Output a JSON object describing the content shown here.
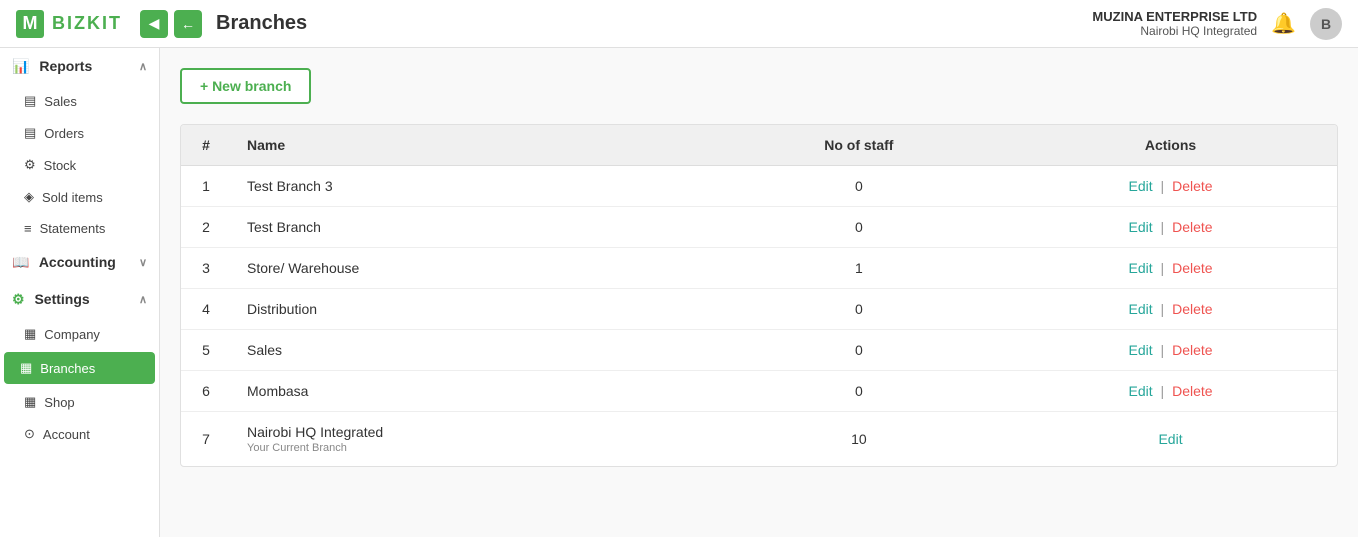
{
  "header": {
    "logo_letter": "M",
    "logo_text": "BIZKIT",
    "page_title": "Branches",
    "company_name": "MUZINA ENTERPRISE LTD",
    "branch_name": "Nairobi HQ Integrated",
    "avatar_letter": "B",
    "nav_back_icon": "◀",
    "nav_arrow_icon": "←"
  },
  "sidebar": {
    "reports_label": "Reports",
    "reports_chevron": "∧",
    "sales_label": "Sales",
    "orders_label": "Orders",
    "stock_label": "Stock",
    "sold_items_label": "Sold items",
    "statements_label": "Statements",
    "accounting_label": "Accounting",
    "accounting_chevron": "∨",
    "settings_label": "Settings",
    "settings_chevron": "∧",
    "company_label": "Company",
    "branches_label": "Branches",
    "shop_label": "Shop",
    "account_label": "Account"
  },
  "main": {
    "new_branch_label": "+ New branch",
    "table": {
      "headers": [
        "#",
        "Name",
        "No of staff",
        "Actions"
      ],
      "rows": [
        {
          "num": "1",
          "name": "Test Branch 3",
          "staff": "0",
          "edit": "Edit",
          "delete": "Delete",
          "sub": ""
        },
        {
          "num": "2",
          "name": "Test Branch",
          "staff": "0",
          "edit": "Edit",
          "delete": "Delete",
          "sub": ""
        },
        {
          "num": "3",
          "name": "Store/ Warehouse",
          "staff": "1",
          "edit": "Edit",
          "delete": "Delete",
          "sub": ""
        },
        {
          "num": "4",
          "name": "Distribution",
          "staff": "0",
          "edit": "Edit",
          "delete": "Delete",
          "sub": ""
        },
        {
          "num": "5",
          "name": "Sales",
          "staff": "0",
          "edit": "Edit",
          "delete": "Delete",
          "sub": ""
        },
        {
          "num": "6",
          "name": "Mombasa",
          "staff": "0",
          "edit": "Edit",
          "delete": "Delete",
          "sub": ""
        },
        {
          "num": "7",
          "name": "Nairobi HQ Integrated",
          "staff": "10",
          "edit": "Edit",
          "delete": "",
          "sub": "Your Current Branch"
        }
      ]
    }
  },
  "colors": {
    "green": "#4caf50",
    "teal": "#26a69a",
    "red": "#ef5350"
  }
}
